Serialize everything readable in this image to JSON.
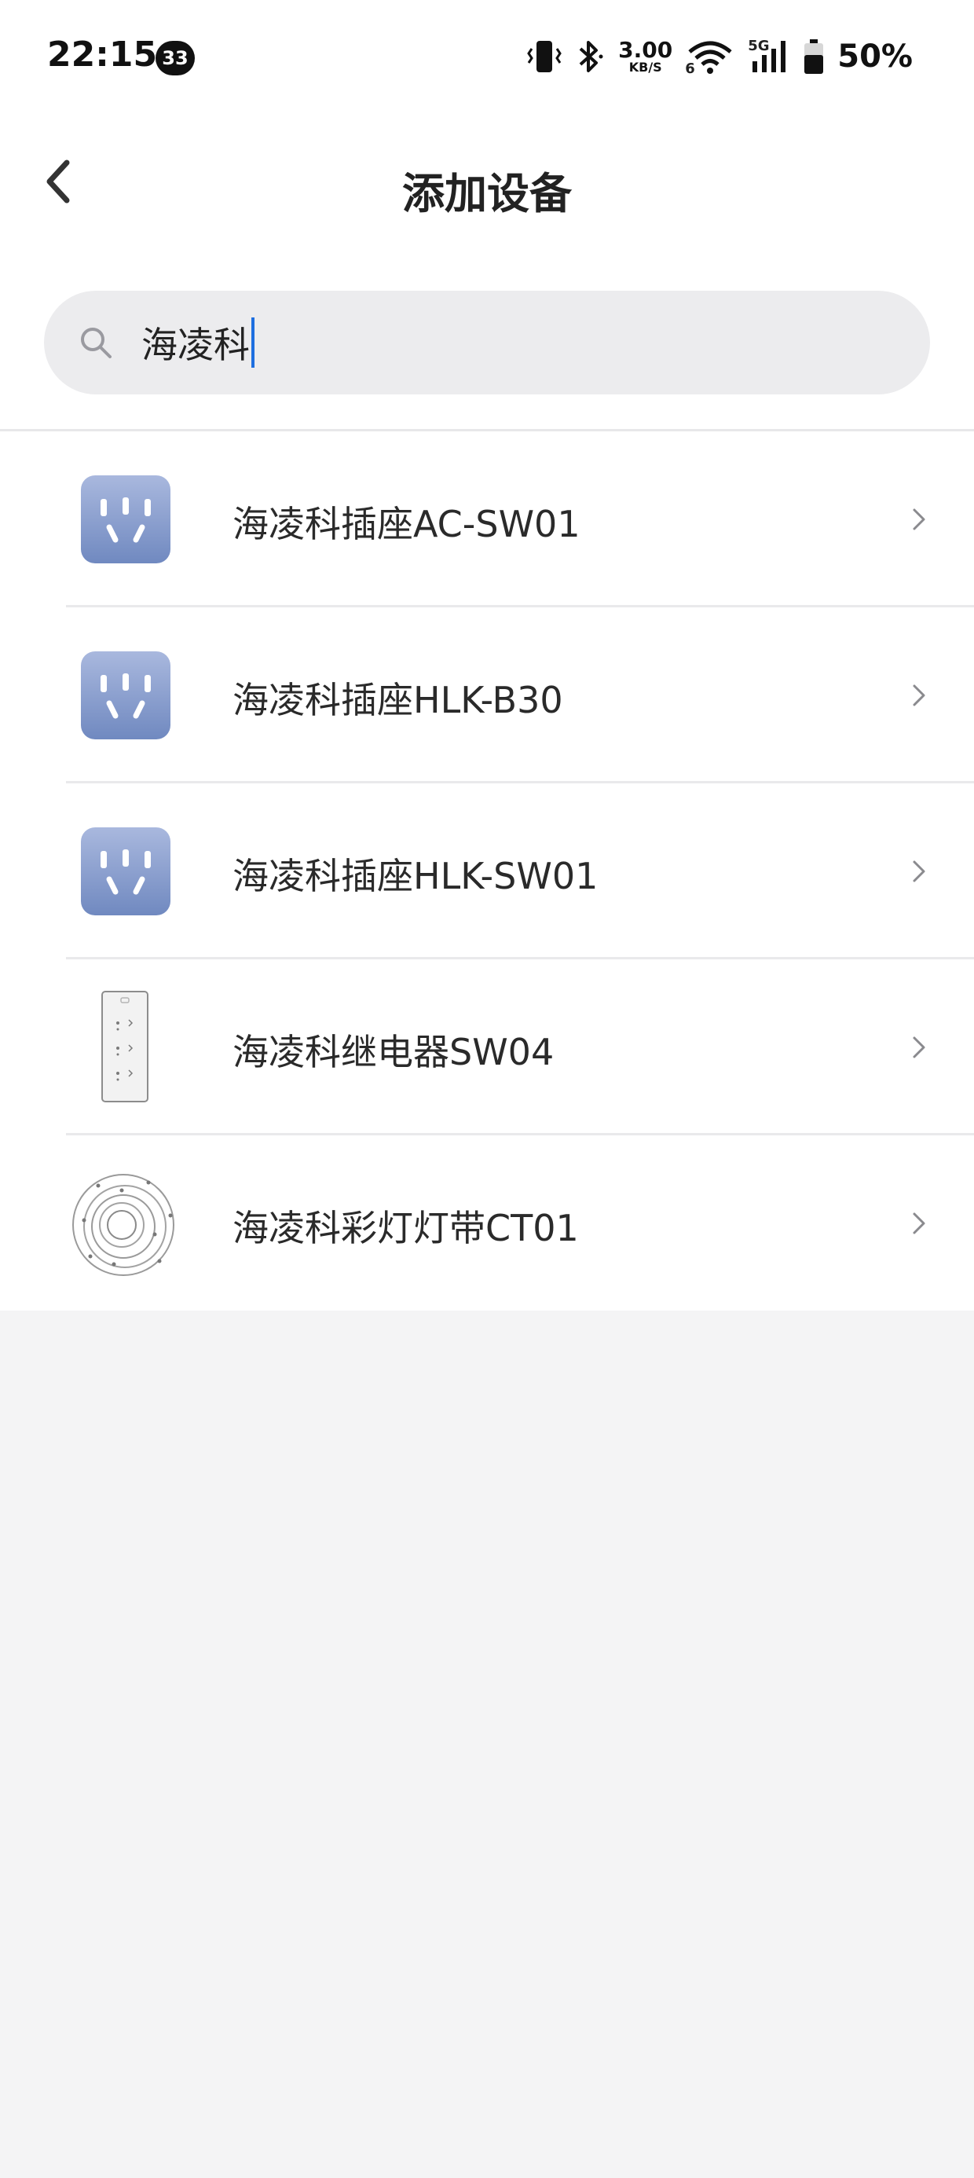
{
  "status_bar": {
    "time": "22:15",
    "notification_count": "33",
    "net_speed_value": "3.00",
    "net_speed_unit": "KB/S",
    "wifi_label": "6",
    "network_label": "5G",
    "battery_percent": "50%"
  },
  "header": {
    "title": "添加设备",
    "back_icon": "chevron-left-icon"
  },
  "search": {
    "value": "海凌科",
    "icon": "search-icon"
  },
  "devices": [
    {
      "name": "海凌科插座AC-SW01",
      "icon": "smart-socket-icon"
    },
    {
      "name": "海凌科插座HLK-B30",
      "icon": "smart-socket-icon"
    },
    {
      "name": "海凌科插座HLK-SW01",
      "icon": "smart-socket-icon"
    },
    {
      "name": "海凌科继电器SW04",
      "icon": "relay-switch-icon"
    },
    {
      "name": "海凌科彩灯灯带CT01",
      "icon": "led-strip-icon"
    }
  ],
  "colors": {
    "accent_caret": "#1e6fe0",
    "socket_gradient_top": "#a9b8de",
    "socket_gradient_bottom": "#7089c0",
    "page_background": "#f4f4f5"
  }
}
